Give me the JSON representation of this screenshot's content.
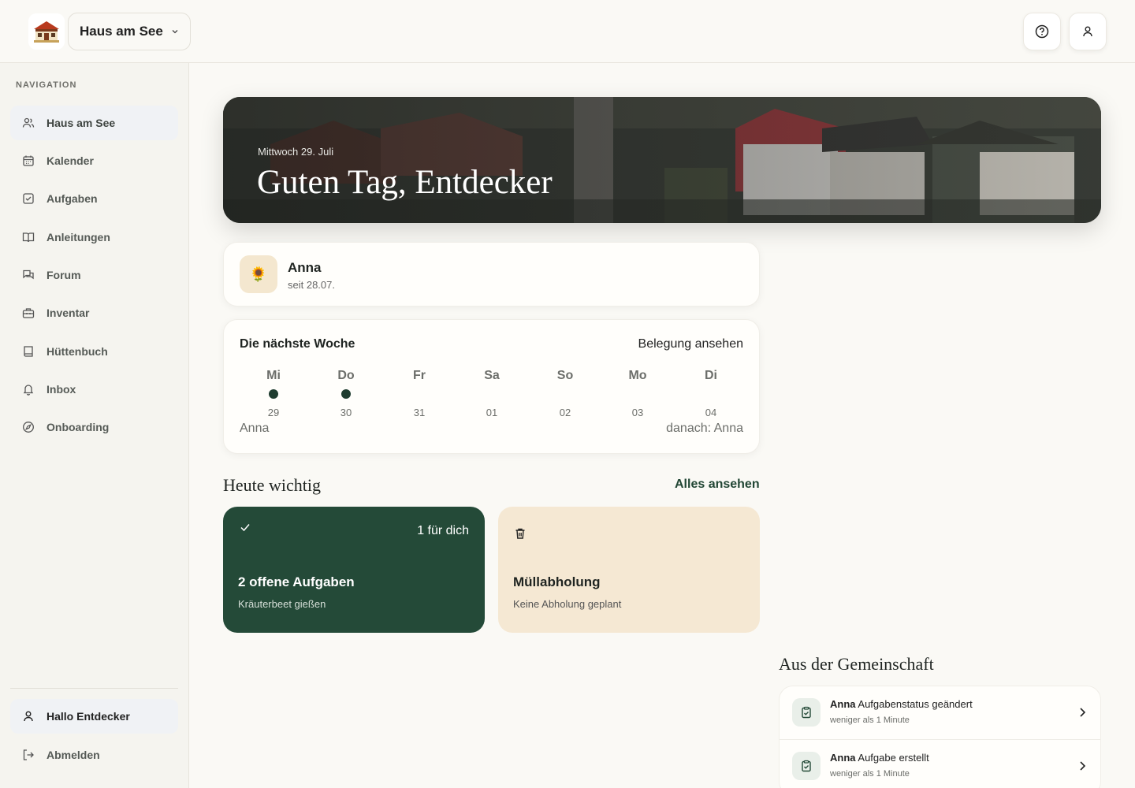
{
  "header": {
    "house_name": "Haus am See",
    "icons": {
      "logo": "house-logo",
      "dropdown": "chevron-down-icon",
      "help": "help-circle-icon",
      "profile": "user-icon"
    }
  },
  "sidebar": {
    "title": "NAVIGATION",
    "items": [
      {
        "label": "Haus am See",
        "icon": "users-icon",
        "active": true
      },
      {
        "label": "Kalender",
        "icon": "calendar-icon"
      },
      {
        "label": "Aufgaben",
        "icon": "checkbox-icon"
      },
      {
        "label": "Anleitungen",
        "icon": "book-open-icon"
      },
      {
        "label": "Forum",
        "icon": "chat-icon"
      },
      {
        "label": "Inventar",
        "icon": "toolbox-icon"
      },
      {
        "label": "Hüttenbuch",
        "icon": "book-icon"
      },
      {
        "label": "Inbox",
        "icon": "bell-icon"
      },
      {
        "label": "Onboarding",
        "icon": "compass-icon"
      }
    ],
    "user_label": "Hallo Entdecker",
    "logout_label": "Abmelden"
  },
  "hero": {
    "date": "Mittwoch 29. Juli",
    "greeting": "Guten Tag, Entdecker"
  },
  "resident": {
    "avatar_emoji": "🌻",
    "name": "Anna",
    "since": "seit 28.07."
  },
  "week": {
    "title": "Die nächste Woche",
    "link": "Belegung ansehen",
    "days": [
      {
        "name": "Mi",
        "num": "29",
        "occupied": true
      },
      {
        "name": "Do",
        "num": "30",
        "occupied": true
      },
      {
        "name": "Fr",
        "num": "31",
        "occupied": false
      },
      {
        "name": "Sa",
        "num": "01",
        "occupied": false
      },
      {
        "name": "So",
        "num": "02",
        "occupied": false
      },
      {
        "name": "Mo",
        "num": "03",
        "occupied": false
      },
      {
        "name": "Di",
        "num": "04",
        "occupied": false
      }
    ],
    "current_guest": "Anna",
    "next_guest": "danach: Anna"
  },
  "today": {
    "title": "Heute wichtig",
    "see_all": "Alles ansehen",
    "tasks": {
      "badge": "1 für dich",
      "title": "2 offene Aufgaben",
      "subtitle": "Kräuterbeet gießen"
    },
    "trash": {
      "title": "Müllabholung",
      "subtitle": "Keine Abholung geplant"
    }
  },
  "community": {
    "title": "Aus der Gemeinschaft",
    "items": [
      {
        "user": "Anna",
        "action": "Aufgabenstatus geändert",
        "time": "weniger als 1 Minute"
      },
      {
        "user": "Anna",
        "action": "Aufgabe erstellt",
        "time": "weniger als 1 Minute"
      }
    ]
  },
  "colors": {
    "accent_green": "#244a38",
    "beige": "#f5e8d3",
    "background": "#faf9f5"
  }
}
